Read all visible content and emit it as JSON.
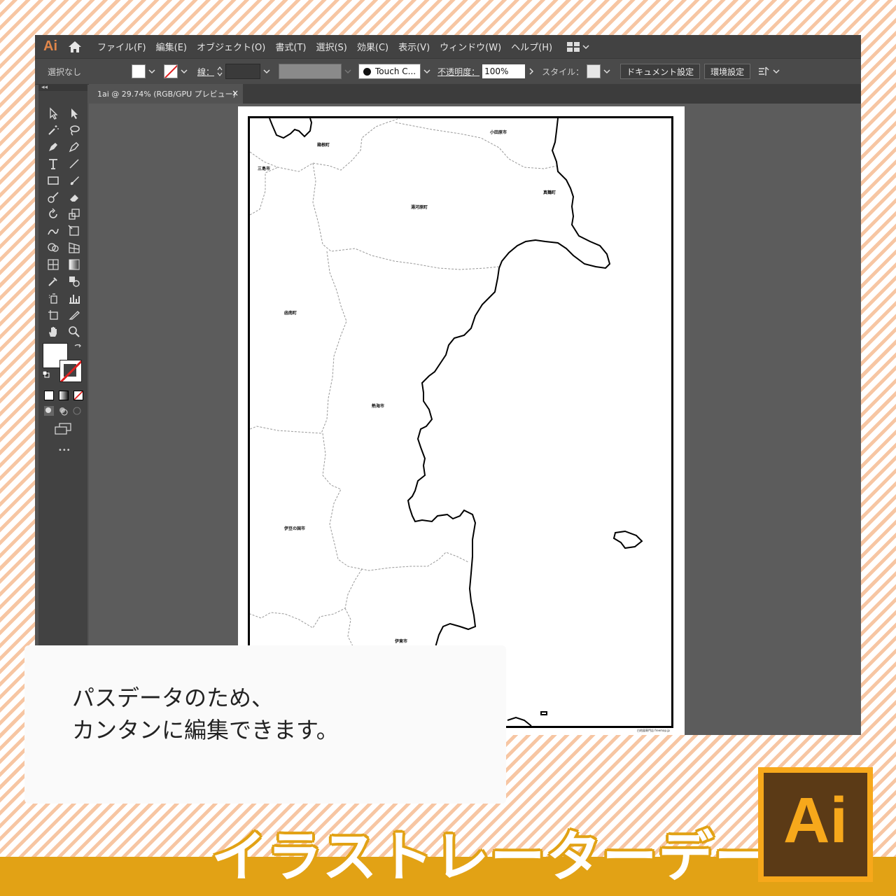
{
  "app": {
    "logo": "Ai",
    "menu": [
      "ファイル(F)",
      "編集(E)",
      "オブジェクト(O)",
      "書式(T)",
      "選択(S)",
      "効果(C)",
      "表示(V)",
      "ウィンドウ(W)",
      "ヘルプ(H)"
    ]
  },
  "control": {
    "selection": "選択なし",
    "stroke_label": "線：",
    "brush": "Touch C...",
    "opacity_label": "不透明度：",
    "opacity_value": "100%",
    "style_label": "スタイル：",
    "doc_setup": "ドキュメント設定",
    "prefs": "環境設定"
  },
  "tab": {
    "title": "1ai @ 29.74% (RGB/GPU プレビュー)",
    "close": "×"
  },
  "toolbox": {
    "collapse": "◂◂",
    "more": "•••"
  },
  "map": {
    "places": [
      "箱根町",
      "小田原市",
      "三島市",
      "真鶴町",
      "湯河原町",
      "函南町",
      "熱海市",
      "伊豆の国市",
      "伊東市"
    ],
    "credit": "白地図専門店 freemap.jp"
  },
  "caption": {
    "line1": "パスデータのため、",
    "line2": "カンタンに編集できます。"
  },
  "banner": {
    "title": "イラストレーターデータ",
    "badge": "Ai"
  },
  "colors": {
    "brand": "#e2a215",
    "ai_orange": "#f7a81b",
    "ai_brown": "#5b3a16"
  }
}
